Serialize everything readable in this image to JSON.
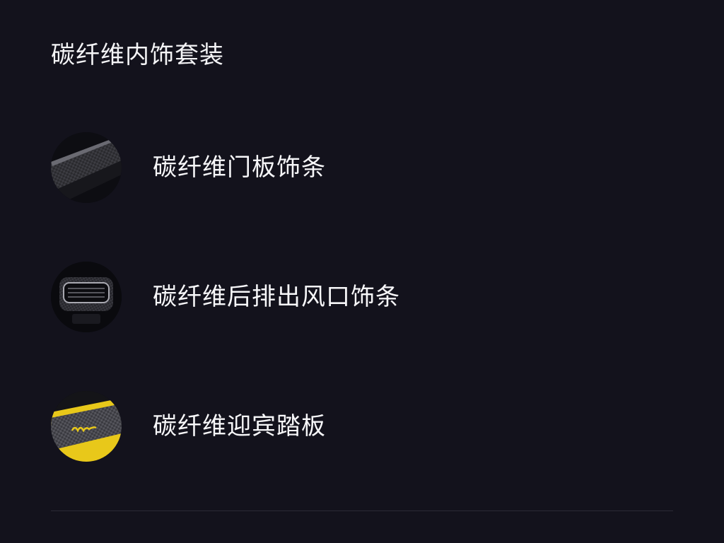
{
  "section": {
    "title": "碳纤维内饰套装"
  },
  "items": [
    {
      "label": "碳纤维门板饰条",
      "thumbnail": "door-trim-thumbnail"
    },
    {
      "label": "碳纤维后排出风口饰条",
      "thumbnail": "rear-vent-thumbnail"
    },
    {
      "label": "碳纤维迎宾踏板",
      "thumbnail": "sill-plate-thumbnail"
    }
  ],
  "colors": {
    "background": "#13121c",
    "text": "#f7f7f9",
    "accent_yellow": "#e8c81a",
    "divider": "#2b2a35"
  }
}
